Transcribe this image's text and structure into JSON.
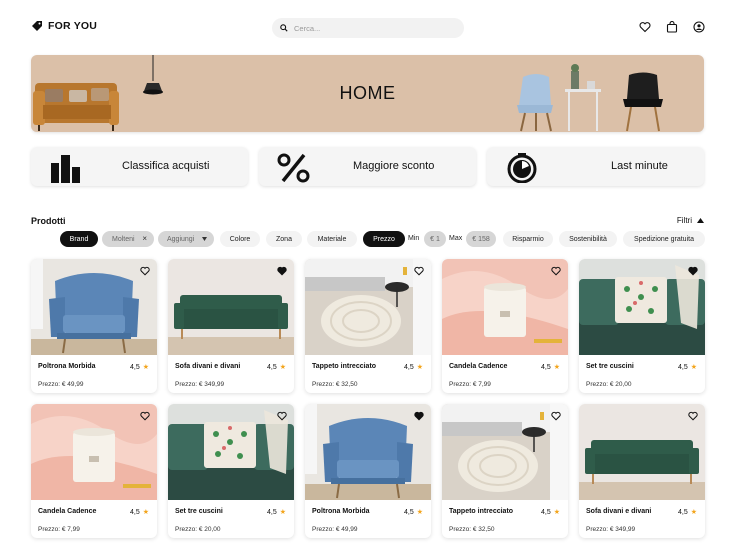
{
  "header": {
    "brand": "FOR YOU",
    "search_placeholder": "Cerca...",
    "icons": [
      "tag-icon",
      "search-icon",
      "heart-icon",
      "bag-icon",
      "user-icon"
    ]
  },
  "banner": {
    "title": "HOME"
  },
  "categories": [
    {
      "label": "Classifica acquisti",
      "icon": "bar-chart-icon"
    },
    {
      "label": "Maggiore sconto",
      "icon": "percent-icon"
    },
    {
      "label": "Last minute",
      "icon": "timer-icon"
    }
  ],
  "products_section": {
    "title": "Prodotti",
    "filters_label": "Filtri"
  },
  "filters": {
    "brand": "Brand",
    "mostrati": "Molteni",
    "aggiungi": "Aggiungi",
    "colore": "Colore",
    "zona": "Zona",
    "materiale": "Materiale",
    "prezzo": "Prezzo",
    "min_label": "Min",
    "min_value": "€ 1",
    "max_label": "Max",
    "max_value": "€ 158",
    "risparmio": "Risparmio",
    "sostenibilita": "Sostenibilità",
    "spedizione": "Spedizione gratuita"
  },
  "products": [
    {
      "name": "Poltrona Morbida",
      "rating": "4,5",
      "price": "Prezzo: € 49,99",
      "favorite": false,
      "image": "armchair"
    },
    {
      "name": "Sofa divani e divani",
      "rating": "4,5",
      "price": "Prezzo: € 349,99",
      "favorite": true,
      "image": "sofa"
    },
    {
      "name": "Tappeto intrecciato",
      "rating": "4,5",
      "price": "Prezzo: € 32,50",
      "favorite": false,
      "image": "rug"
    },
    {
      "name": "Candela Cadence",
      "rating": "4,5",
      "price": "Prezzo: € 7,99",
      "favorite": false,
      "image": "candle"
    },
    {
      "name": "Set tre cuscini",
      "rating": "4,5",
      "price": "Prezzo: € 20,00",
      "favorite": true,
      "image": "cushions"
    },
    {
      "name": "Candela Cadence",
      "rating": "4,5",
      "price": "Prezzo: € 7,99",
      "favorite": false,
      "image": "candle"
    },
    {
      "name": "Set tre cuscini",
      "rating": "4,5",
      "price": "Prezzo: € 20,00",
      "favorite": false,
      "image": "cushions"
    },
    {
      "name": "Poltrona Morbida",
      "rating": "4,5",
      "price": "Prezzo: € 49,99",
      "favorite": true,
      "image": "armchair"
    },
    {
      "name": "Tappeto intrecciato",
      "rating": "4,5",
      "price": "Prezzo: € 32,50",
      "favorite": false,
      "image": "rug"
    },
    {
      "name": "Sofa divani e divani",
      "rating": "4,5",
      "price": "Prezzo: € 349,99",
      "favorite": false,
      "image": "sofa"
    }
  ],
  "colors": {
    "banner": "#dbc0a8",
    "star": "#f3a51c",
    "chip_dark": "#111111"
  }
}
